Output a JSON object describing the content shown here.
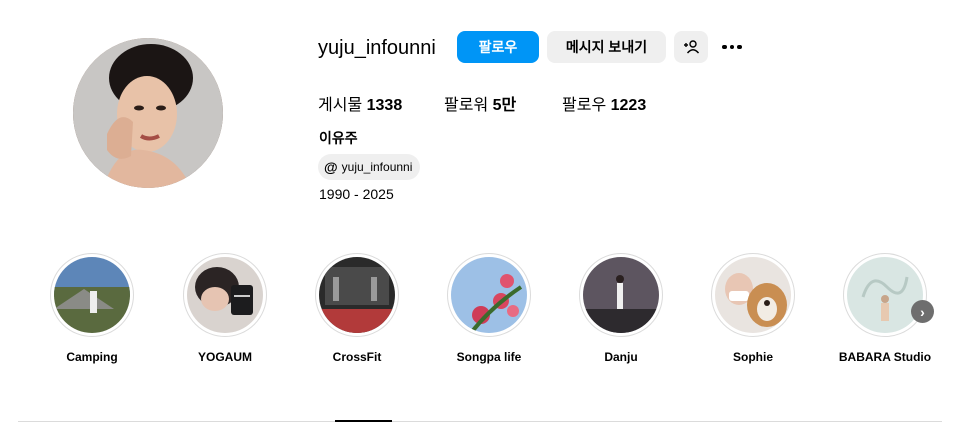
{
  "profile": {
    "username": "yuju_infounni",
    "follow_label": "팔로우",
    "message_label": "메시지 보내기",
    "suggest_icon": "person-plus-icon",
    "more_icon": "more-options-icon",
    "full_name": "이유주",
    "threads_handle": "yuju_infounni",
    "threads_icon": "threads-icon",
    "bio": "1990 - 2025"
  },
  "stats": {
    "posts_label": "게시물",
    "posts_value": "1338",
    "followers_label": "팔로워",
    "followers_value": "5만",
    "following_label": "팔로우",
    "following_value": "1223"
  },
  "highlights": [
    {
      "label": "Camping"
    },
    {
      "label": "YOGAUM"
    },
    {
      "label": "CrossFit"
    },
    {
      "label": "Songpa life"
    },
    {
      "label": "Danju"
    },
    {
      "label": "Sophie"
    },
    {
      "label": "BABARA Studio"
    }
  ],
  "highlights_next_icon": "chevron-right-icon",
  "colors": {
    "accent": "#0095f6",
    "secondary_button": "#efefef",
    "divider": "#dbdbdb"
  }
}
